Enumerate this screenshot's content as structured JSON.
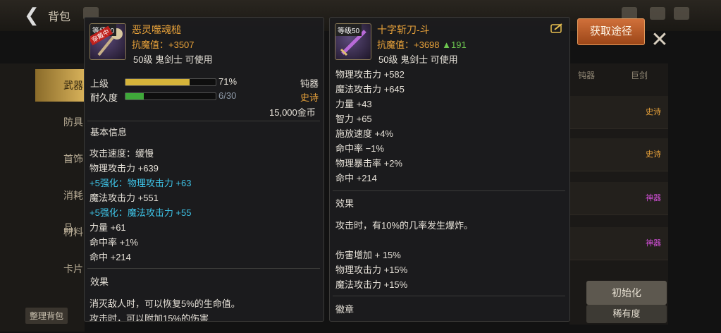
{
  "background": {
    "title": "背包",
    "side_items": [
      "武器",
      "防具",
      "首饰",
      "消耗品",
      "材料",
      "卡片"
    ],
    "bottom_left_btn": "整理背包",
    "right_tabs": [
      "钝器",
      "巨剑"
    ],
    "right_tags": [
      {
        "text": "史诗",
        "color": "#e8a23a"
      },
      {
        "text": "史诗",
        "color": "#e8a23a"
      },
      {
        "text": "神器",
        "color": "#d14fd6"
      },
      {
        "text": "神器",
        "color": "#d14fd6"
      }
    ],
    "init_btn": "初始化",
    "rarity_btn": "稀有度",
    "acquire_label": "获取途径"
  },
  "left_item": {
    "level_badge": "等级50",
    "worn_tag": "穿戴中",
    "name": "恶灵噬魂槌",
    "resist": "抗魔值：+3507",
    "usable": "50级 鬼剑士 可使用",
    "grade_label": "上级",
    "grade_percent": "71%",
    "grade_value": 0.71,
    "type": "钝器",
    "durability_label": "耐久度",
    "durability_value": "6/30",
    "durability_fraction": 0.2,
    "rarity": "史诗",
    "price": "15,000金币",
    "basic_title": "基本信息",
    "stats": [
      {
        "text": "攻击速度：缓慢",
        "color": "normal"
      },
      {
        "text": "物理攻击力 +639",
        "color": "normal"
      },
      {
        "text": "+5强化：物理攻击力 +63",
        "color": "cyan"
      },
      {
        "text": "魔法攻击力 +551",
        "color": "normal"
      },
      {
        "text": "+5强化：魔法攻击力 +55",
        "color": "cyan"
      },
      {
        "text": "力量 +61",
        "color": "normal"
      },
      {
        "text": "命中率 +1%",
        "color": "normal"
      },
      {
        "text": "命中 +214",
        "color": "normal"
      }
    ],
    "effect_title": "效果",
    "effects": [
      "消灭敌人时，可以恢复5%的生命值。",
      "攻击时，可以附加15%的伤害"
    ]
  },
  "right_item": {
    "level_badge": "等级50",
    "name": "十字斩刀-斗",
    "resist": "抗魔值：+3698",
    "resist_diff": "▲191",
    "usable": "50级 鬼剑士 可使用",
    "stats": [
      "物理攻击力 +582",
      "魔法攻击力 +645",
      "力量 +43",
      "智力 +65",
      "施放速度 +4%",
      "命中率 −1%",
      "物理暴击率 +2%",
      "命中 +214"
    ],
    "effect_title": "效果",
    "effects": [
      "攻击时，有10%的几率发生爆炸。",
      "",
      "伤害增加 + 15%",
      "物理攻击力 +15%",
      "魔法攻击力 +15%"
    ],
    "emblem_title": "徽章"
  },
  "colors": {
    "name_gold": "#e8a23a",
    "enhance_cyan": "#3ec4e8",
    "diff_green": "#6ec850",
    "grade_bar": "#d6b43a",
    "durability_bar": "#3fa83a"
  }
}
